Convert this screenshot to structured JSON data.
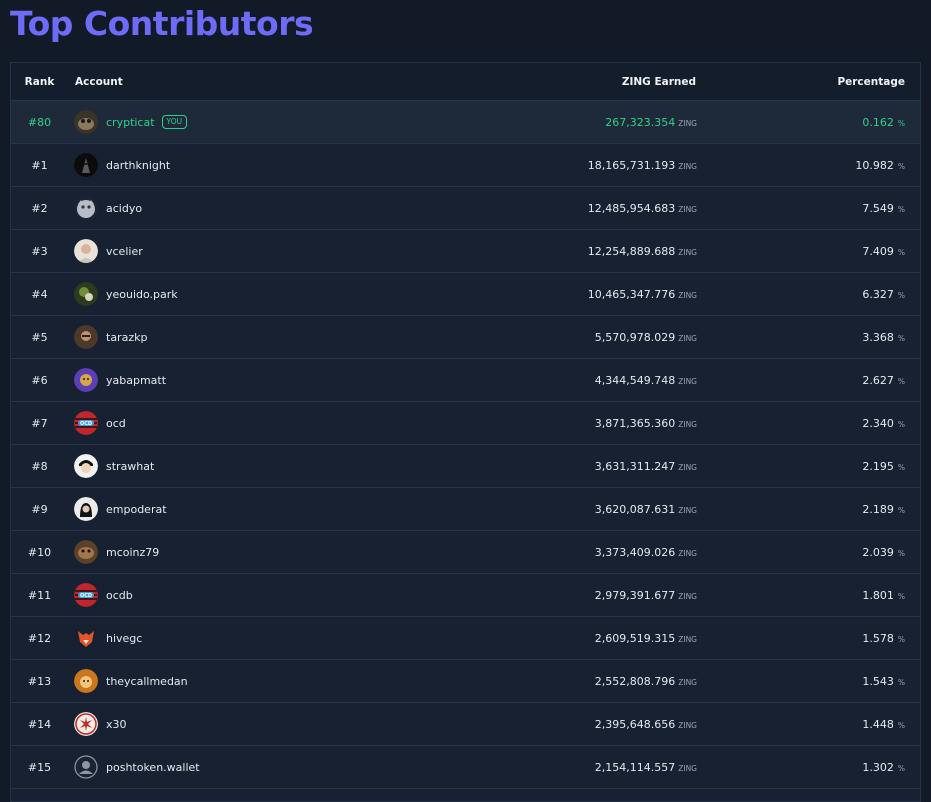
{
  "page": {
    "title": "Top Contributors"
  },
  "table": {
    "headers": {
      "rank": "Rank",
      "account": "Account",
      "zing": "ZING Earned",
      "percentage": "Percentage"
    },
    "unit_zing": "ZING",
    "unit_pct": "%",
    "you_badge": "YOU",
    "rows": [
      {
        "rank": "#80",
        "account": "crypticat",
        "zing": "267,323.354",
        "pct": "0.162",
        "you": true,
        "avatar": "cat-avatar"
      },
      {
        "rank": "#1",
        "account": "darthknight",
        "zing": "18,165,731.193",
        "pct": "10.982",
        "avatar": "knight-avatar"
      },
      {
        "rank": "#2",
        "account": "acidyo",
        "zing": "12,485,954.683",
        "pct": "7.549",
        "avatar": "blob-avatar"
      },
      {
        "rank": "#3",
        "account": "vcelier",
        "zing": "12,254,889.688",
        "pct": "7.409",
        "avatar": "person-avatar"
      },
      {
        "rank": "#4",
        "account": "yeouido.park",
        "zing": "10,465,347.776",
        "pct": "6.327",
        "avatar": "park-avatar"
      },
      {
        "rank": "#5",
        "account": "tarazkp",
        "zing": "5,570,978.029",
        "pct": "3.368",
        "avatar": "man-avatar"
      },
      {
        "rank": "#6",
        "account": "yabapmatt",
        "zing": "4,344,549.748",
        "pct": "2.627",
        "avatar": "cartoon-avatar"
      },
      {
        "rank": "#7",
        "account": "ocd",
        "zing": "3,871,365.360",
        "pct": "2.340",
        "avatar": "ocd-logo"
      },
      {
        "rank": "#8",
        "account": "strawhat",
        "zing": "3,631,311.247",
        "pct": "2.195",
        "avatar": "anime-avatar"
      },
      {
        "rank": "#9",
        "account": "empoderat",
        "zing": "3,620,087.631",
        "pct": "2.189",
        "avatar": "portrait-avatar"
      },
      {
        "rank": "#10",
        "account": "mcoinz79",
        "zing": "3,373,409.026",
        "pct": "2.039",
        "avatar": "monster-avatar"
      },
      {
        "rank": "#11",
        "account": "ocdb",
        "zing": "2,979,391.677",
        "pct": "1.801",
        "avatar": "ocd-logo"
      },
      {
        "rank": "#12",
        "account": "hivegc",
        "zing": "2,609,519.315",
        "pct": "1.578",
        "avatar": "fox-avatar"
      },
      {
        "rank": "#13",
        "account": "theycallmedan",
        "zing": "2,552,808.796",
        "pct": "1.543",
        "avatar": "lion-avatar"
      },
      {
        "rank": "#14",
        "account": "x30",
        "zing": "2,395,648.656",
        "pct": "1.448",
        "avatar": "leaf-avatar"
      },
      {
        "rank": "#15",
        "account": "poshtoken.wallet",
        "zing": "2,154,114.557",
        "pct": "1.302",
        "avatar": "default-user-avatar"
      }
    ]
  }
}
